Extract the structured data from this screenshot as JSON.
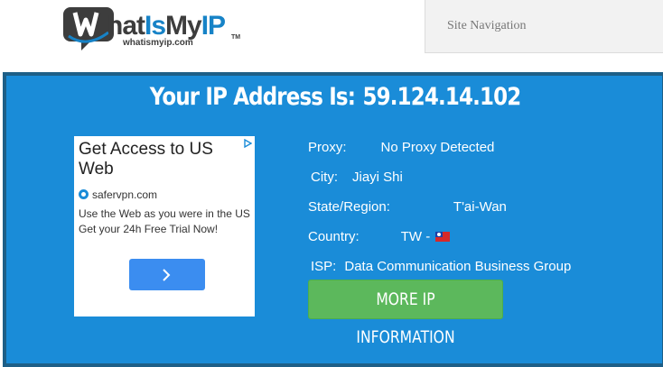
{
  "header": {
    "logo": {
      "word1_initial": "W",
      "word1_rest": "hat",
      "word2": "Is",
      "word3": "My",
      "word4": "IP",
      "tm": "TM",
      "domain": "whatismyip.com"
    },
    "site_nav_label": "Site Navigation"
  },
  "main": {
    "heading_label": "Your IP Address Is:",
    "ip_address": "59.124.14.102",
    "details": {
      "proxy_label": "Proxy:",
      "proxy_value": "No Proxy Detected",
      "city_label": "City:",
      "city_value": "Jiayi Shi",
      "state_label": "State/Region:",
      "state_value": "T'ai-Wan",
      "country_label": "Country:",
      "country_value": "TW -",
      "isp_label": "ISP:",
      "isp_value": "Data Communication Business Group"
    },
    "more_button_label": "MORE IP INFORMATION"
  },
  "ad": {
    "title": "Get Access to US Web",
    "domain": "safervpn.com",
    "body": "Use the Web as you were in the US Get your 24h Free Trial Now!"
  },
  "colors": {
    "panel_bg": "#1a8cd8",
    "panel_border": "#1e5f87",
    "button_green": "#5cb85c",
    "brand_blue": "#1783c7"
  },
  "icons": {
    "flag": "taiwan-flag-icon",
    "ad_button": "chevron-right-icon",
    "ad_choices": "ad-choices-icon",
    "ad_domain": "safervpn-logo-icon"
  }
}
